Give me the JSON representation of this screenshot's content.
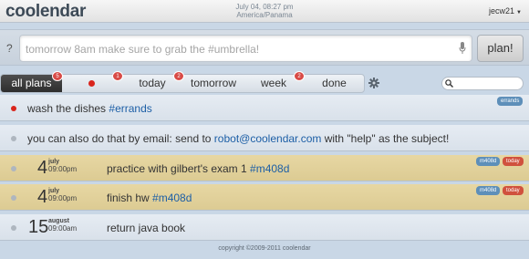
{
  "header": {
    "logo": "coolendar",
    "date_line": "July 04, 08:27 pm",
    "tz_line": "America/Panama",
    "user": "jecw21",
    "user_caret": "▼"
  },
  "input": {
    "help_label": "?",
    "placeholder": "tomorrow 8am make sure to grab the #umbrella!",
    "mic_icon": "microphone-icon",
    "submit_label": "plan!"
  },
  "tabs": [
    {
      "label": "all plans",
      "count": "5",
      "active": true
    },
    {
      "label": "",
      "count": "1",
      "icon": "red-dot"
    },
    {
      "label": "today",
      "count": "2"
    },
    {
      "label": "tomorrow",
      "count": ""
    },
    {
      "label": "week",
      "count": "2"
    },
    {
      "label": "done",
      "count": ""
    }
  ],
  "settings_icon": "gear-icon",
  "search": {
    "icon": "search-icon",
    "value": ""
  },
  "items": [
    {
      "text": "wash the dishes ",
      "tag": "#errands",
      "badges": [
        "errands"
      ],
      "bullet": "red"
    },
    {
      "text": "you can also do that by email: send to ",
      "link": "robot@coolendar.com",
      "suffix": " with \"help\" as the subject!",
      "bullet": "gray"
    },
    {
      "day": "4",
      "month": "july",
      "time": "09:00pm",
      "text": "practice with gilbert's exam 1 ",
      "tag": "#m408d",
      "badges": [
        "m408d",
        "today"
      ]
    },
    {
      "day": "4",
      "month": "july",
      "time": "09:00pm",
      "text": "finish hw ",
      "tag": "#m408d",
      "badges": [
        "m408d",
        "today"
      ]
    },
    {
      "day": "15",
      "month": "august",
      "time": "09:00am",
      "text": "return java book",
      "badges": []
    }
  ],
  "footer": "copyright ©2009-2011 coolendar",
  "colors": {
    "accent_red": "#d9251c",
    "tag_blue": "#1d5fa6",
    "due_highlight": "#e7d7a3"
  }
}
